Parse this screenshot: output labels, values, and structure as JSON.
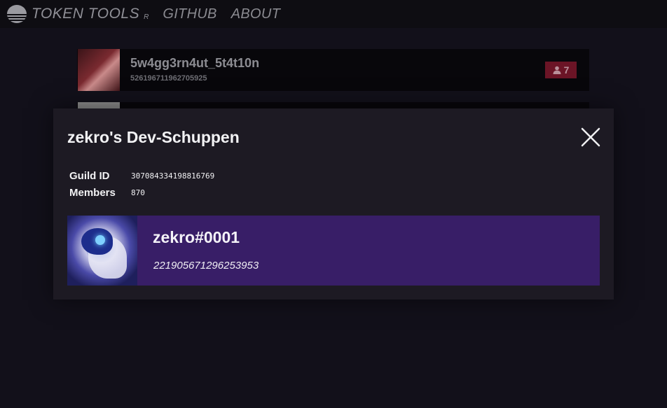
{
  "header": {
    "logo_text": "TOKEN TOOLS",
    "logo_sub": "R",
    "nav": [
      "GITHUB",
      "ABOUT"
    ]
  },
  "guild_list": [
    {
      "name": "5w4gg3rn4ut_5t4t10n",
      "id": "526196711962705925",
      "member_count": "7"
    },
    {
      "name": "",
      "id": "",
      "member_count": ""
    }
  ],
  "modal": {
    "title": "zekro's Dev-Schuppen",
    "guild_id_label": "Guild ID",
    "guild_id": "307084334198816769",
    "members_label": "Members",
    "members": "870",
    "owner": {
      "tag": "zekro#0001",
      "id": "221905671296253953"
    }
  },
  "colors": {
    "background": "#12101a",
    "header": "#0e0d12",
    "modal": "#1d1a23",
    "owner_card": "#381e67",
    "member_badge": "#6b1426"
  }
}
